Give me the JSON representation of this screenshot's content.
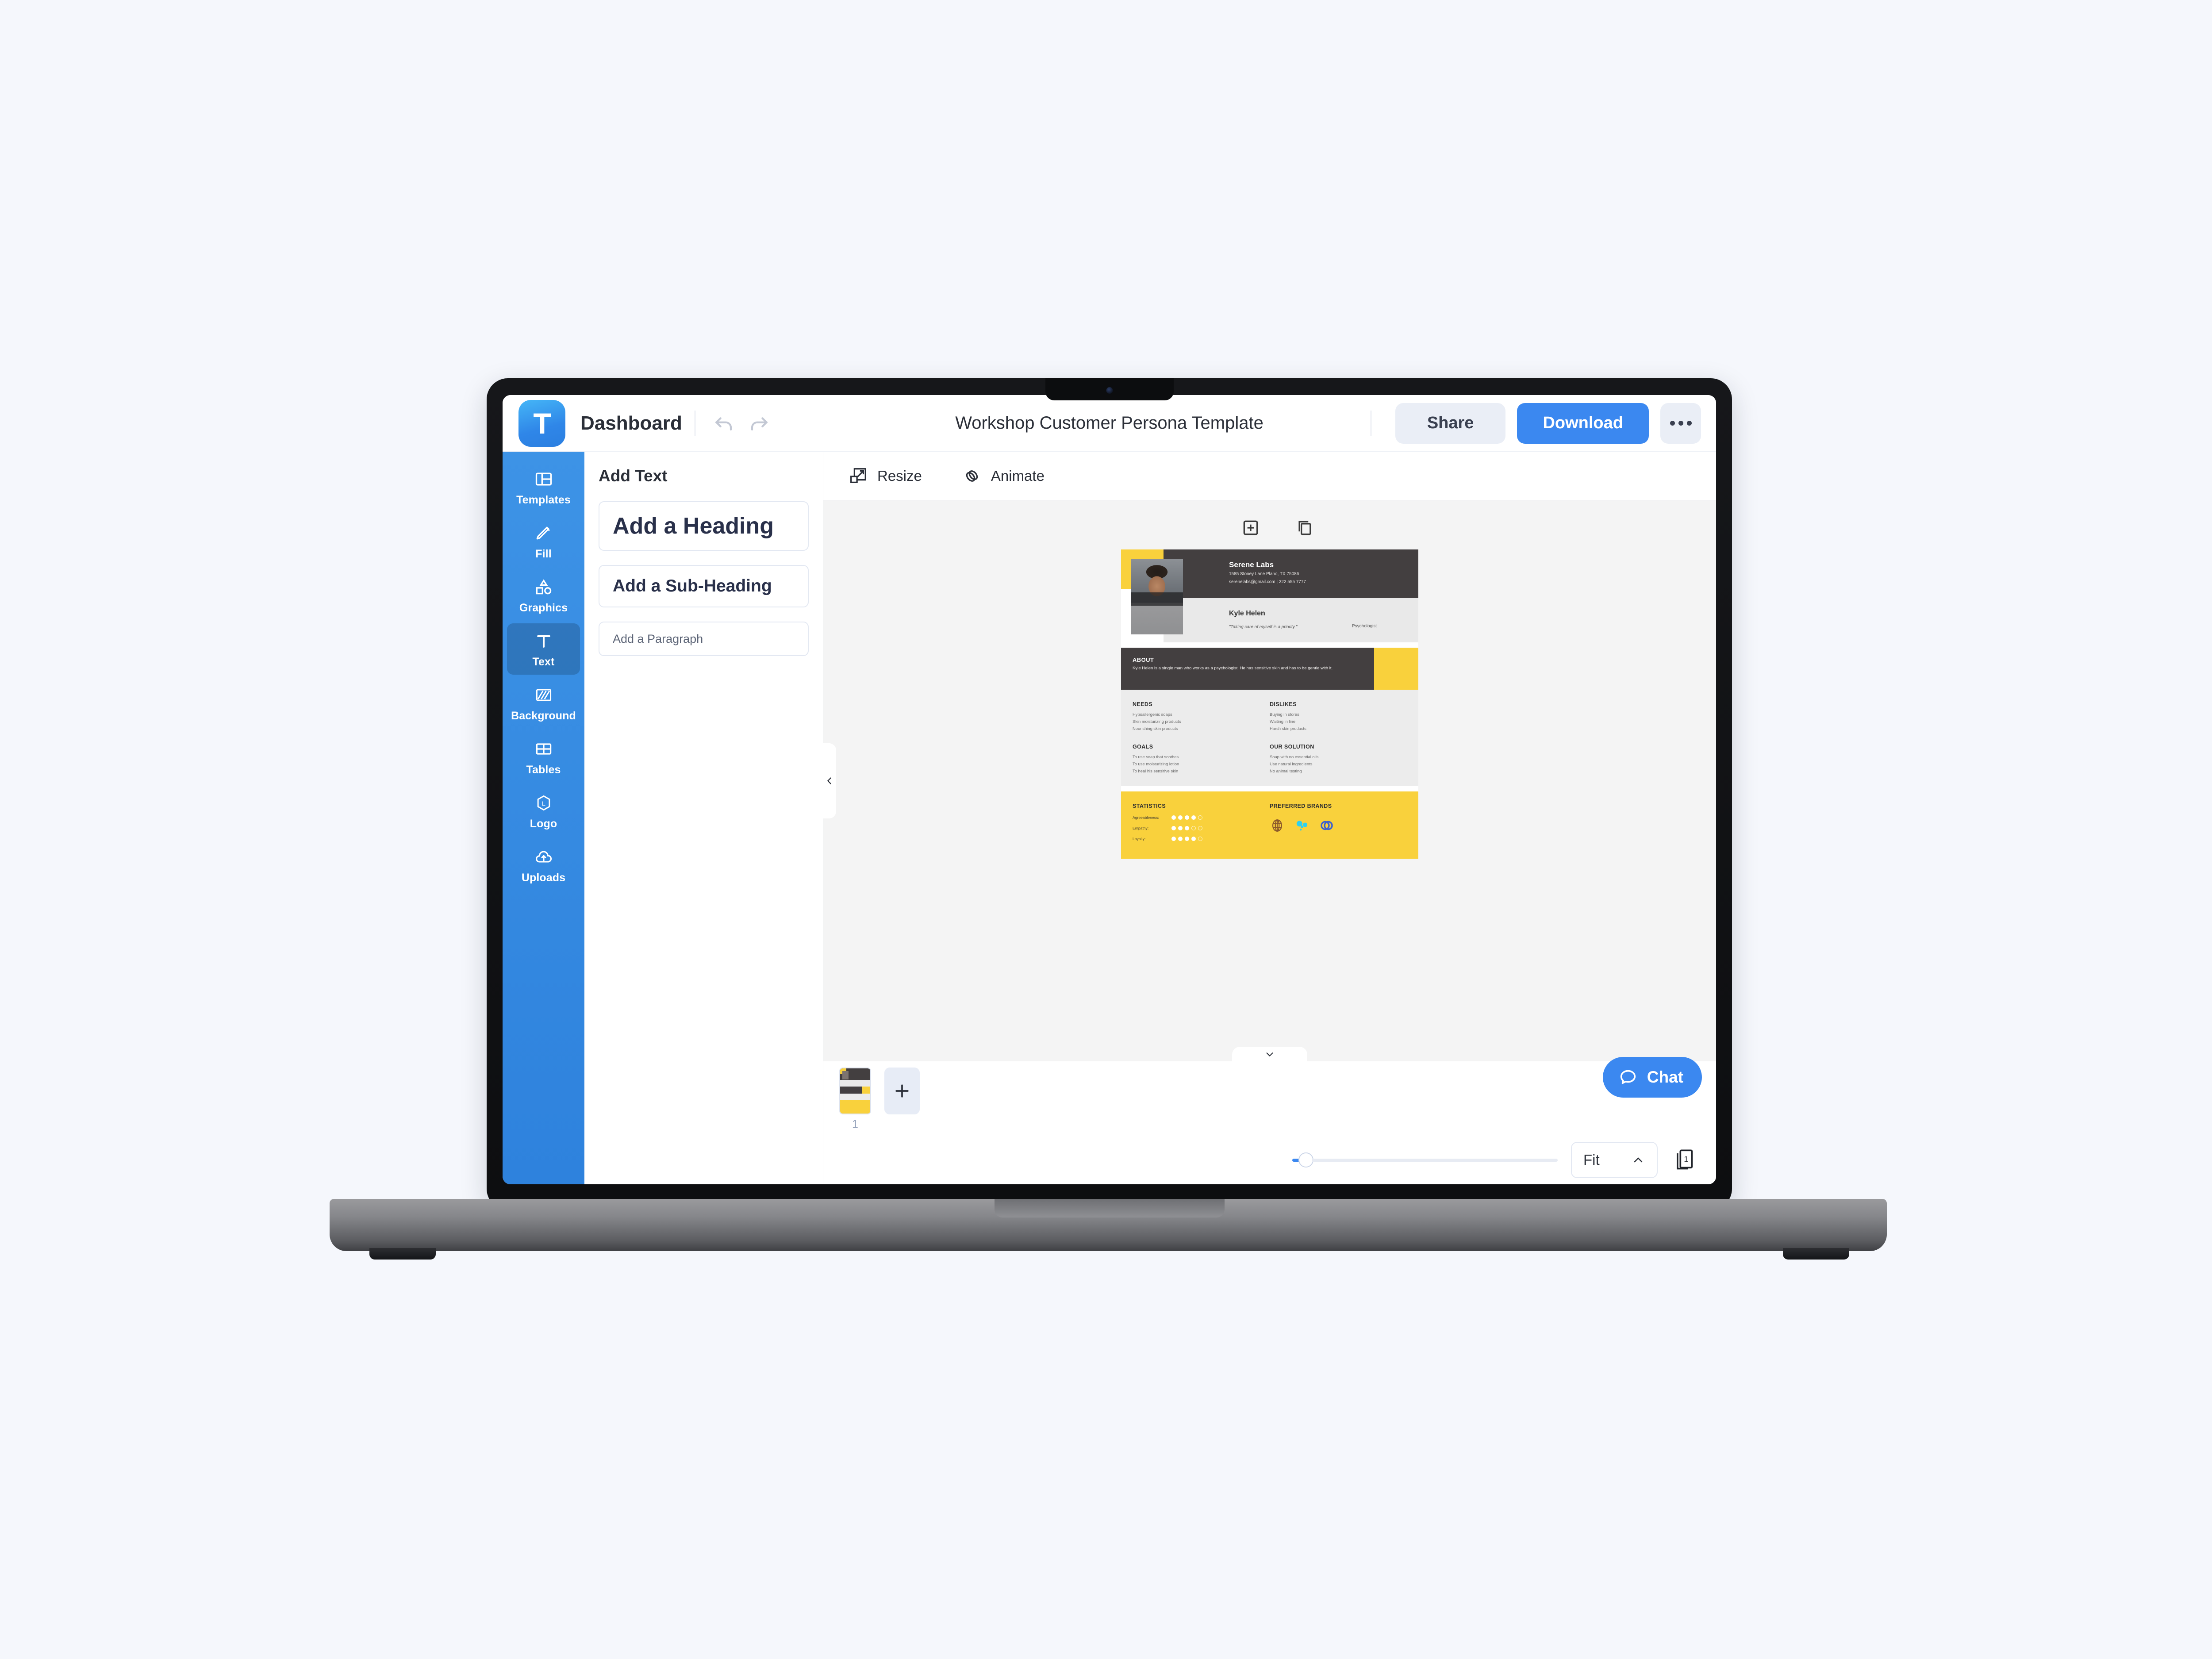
{
  "topbar": {
    "logo_letter": "T",
    "dashboard_label": "Dashboard",
    "undo_icon": "undo-icon",
    "redo_icon": "redo-icon",
    "doc_title": "Workshop Customer Persona Template",
    "share_label": "Share",
    "download_label": "Download",
    "more_icon": "ellipsis-icon"
  },
  "left_rail": {
    "items": [
      {
        "label": "Templates",
        "icon": "templates-icon",
        "active": false
      },
      {
        "label": "Fill",
        "icon": "pencil-icon",
        "active": false
      },
      {
        "label": "Graphics",
        "icon": "shapes-icon",
        "active": false
      },
      {
        "label": "Text",
        "icon": "text-icon",
        "active": true
      },
      {
        "label": "Background",
        "icon": "background-icon",
        "active": false
      },
      {
        "label": "Tables",
        "icon": "table-icon",
        "active": false
      },
      {
        "label": "Logo",
        "icon": "logo-icon",
        "active": false
      },
      {
        "label": "Uploads",
        "icon": "upload-cloud-icon",
        "active": false
      }
    ]
  },
  "text_panel": {
    "title": "Add Text",
    "options": [
      {
        "label": "Add a Heading"
      },
      {
        "label": "Add a Sub-Heading"
      },
      {
        "label": "Add a Paragraph"
      }
    ]
  },
  "canvas_toolbar": {
    "resize_label": "Resize",
    "animate_label": "Animate",
    "resize_icon": "resize-icon",
    "animate_icon": "animate-icon"
  },
  "canvas_actions": {
    "add_icon": "add-page-square-icon",
    "duplicate_icon": "duplicate-icon",
    "collapse_icon": "chevron-left-icon",
    "expand_icon": "chevron-down-icon"
  },
  "design": {
    "brand_name": "Serene Labs",
    "brand_address": "1585 Stoney Lane Plano, TX 75086",
    "brand_contact": "serenelabs@gmail.com | 222 555 7777",
    "person_name": "Kyle Helen",
    "person_quote": "\"Taking care of myself is a priority.\"",
    "person_role": "Psychologist",
    "about_title": "ABOUT",
    "about_body": "Kyle Helen is a single man who works as a psychologist. He has sensitive skin and has to be gentle with it.",
    "columns": [
      {
        "title": "NEEDS",
        "items": [
          "Hypoallergenic soaps",
          "Skin moisturizing products",
          "Nourishing skin products"
        ]
      },
      {
        "title": "DISLIKES",
        "items": [
          "Buying in stores",
          "Waiting in line",
          "Harsh skin products"
        ]
      },
      {
        "title": "GOALS",
        "items": [
          "To use soap that soothes",
          "To use moisturizing lotion",
          "To heal his sensitive skin"
        ]
      },
      {
        "title": "OUR SOLUTION",
        "items": [
          "Soap with no essential oils",
          "Use natural ingredients",
          "No animal testing"
        ]
      }
    ],
    "statistics_title": "STATISTICS",
    "statistics": [
      {
        "label": "Agreeableness:",
        "filled": 4,
        "total": 5
      },
      {
        "label": "Empathy:",
        "filled": 3,
        "total": 5
      },
      {
        "label": "Loyalty:",
        "filled": 4,
        "total": 5
      }
    ],
    "brands_title": "PREFERRED BRANDS",
    "brands": [
      {
        "icon": "globe-grid-icon",
        "color": "#8c5a2b"
      },
      {
        "icon": "splash-drops-icon",
        "color": "#2ed0f0"
      },
      {
        "icon": "interlocking-circles-icon",
        "color": "#3a5fd0"
      }
    ],
    "colors": {
      "yellow": "#f9d13c",
      "dark": "#433f40",
      "light_gray": "#ececec"
    }
  },
  "page_strip": {
    "page_number": "1",
    "add_page_icon": "plus-icon"
  },
  "chat": {
    "label": "Chat",
    "icon": "chat-bubble-icon"
  },
  "bottombar": {
    "zoom_value": "Fit",
    "zoom_chevron_icon": "chevron-up-icon",
    "pages_icon": "pages-count-icon",
    "pages_count": "1"
  },
  "colors": {
    "page_background": "#f5f7fc",
    "accent_blue": "#3b88f0",
    "rail_blue": "#3d93e6",
    "chip_gray": "#eaeef6"
  }
}
